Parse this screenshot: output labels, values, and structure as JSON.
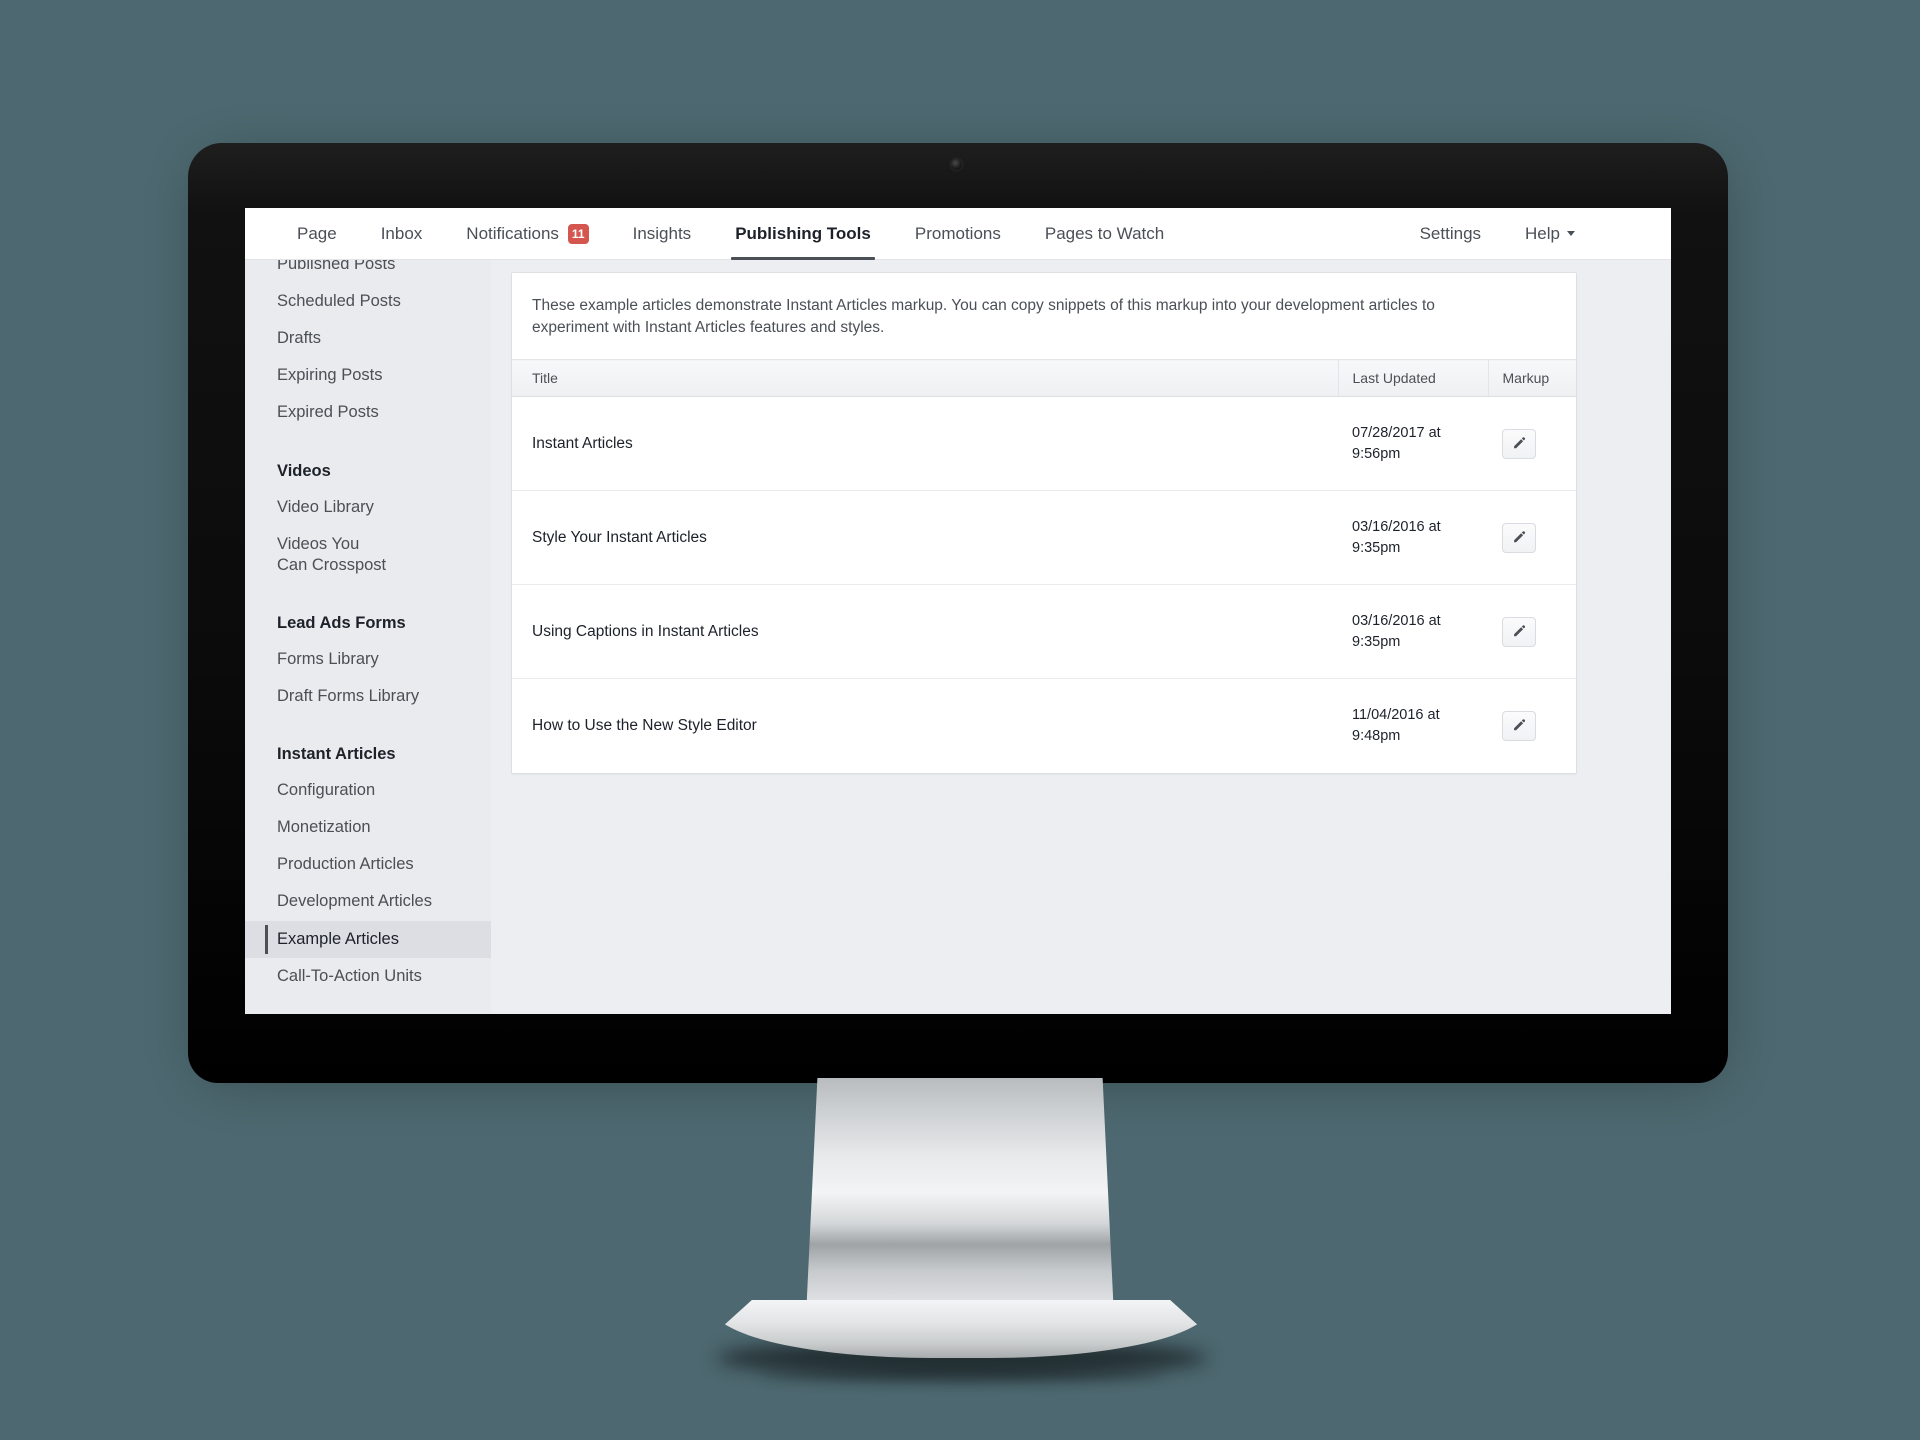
{
  "background_color": "#4d6870",
  "device": {
    "type": "desktop-monitor",
    "camera_label": "webcam"
  },
  "topnav": {
    "left_items": [
      {
        "label": "Page",
        "active": false
      },
      {
        "label": "Inbox",
        "active": false
      },
      {
        "label": "Notifications",
        "active": false,
        "badge": "11"
      },
      {
        "label": "Insights",
        "active": false
      },
      {
        "label": "Publishing Tools",
        "active": true
      },
      {
        "label": "Promotions",
        "active": false
      },
      {
        "label": "Pages to Watch",
        "active": false
      }
    ],
    "right_items": [
      {
        "label": "Settings",
        "caret": false
      },
      {
        "label": "Help",
        "caret": true
      }
    ],
    "badge_color": "#d4564f",
    "active_underline_color": "#4b4f56"
  },
  "sidebar": {
    "groups": [
      {
        "heading": null,
        "items": [
          {
            "label": "Published Posts",
            "selected": false,
            "clipped": true
          },
          {
            "label": "Scheduled Posts",
            "selected": false
          },
          {
            "label": "Drafts",
            "selected": false
          },
          {
            "label": "Expiring Posts",
            "selected": false
          },
          {
            "label": "Expired Posts",
            "selected": false
          }
        ]
      },
      {
        "heading": "Videos",
        "items": [
          {
            "label": "Video Library",
            "selected": false
          },
          {
            "label": "Videos You Can Crosspost",
            "selected": false
          }
        ]
      },
      {
        "heading": "Lead Ads Forms",
        "items": [
          {
            "label": "Forms Library",
            "selected": false
          },
          {
            "label": "Draft Forms Library",
            "selected": false
          }
        ]
      },
      {
        "heading": "Instant Articles",
        "items": [
          {
            "label": "Configuration",
            "selected": false
          },
          {
            "label": "Monetization",
            "selected": false
          },
          {
            "label": "Production Articles",
            "selected": false
          },
          {
            "label": "Development Articles",
            "selected": false
          },
          {
            "label": "Example Articles",
            "selected": true
          },
          {
            "label": "Call-To-Action Units",
            "selected": false
          }
        ]
      }
    ]
  },
  "main": {
    "description": "These example articles demonstrate Instant Articles markup. You can copy snippets of this markup into your development articles to experiment with Instant Articles features and styles.",
    "table": {
      "columns": [
        "Title",
        "Last Updated",
        "Markup"
      ],
      "rows": [
        {
          "title": "Instant Articles",
          "last_updated": "07/28/2017 at 9:56pm",
          "markup_icon": "pencil-icon"
        },
        {
          "title": "Style Your Instant Articles",
          "last_updated": "03/16/2016 at 9:35pm",
          "markup_icon": "pencil-icon"
        },
        {
          "title": "Using Captions in Instant Articles",
          "last_updated": "03/16/2016 at 9:35pm",
          "markup_icon": "pencil-icon"
        },
        {
          "title": "How to Use the New Style Editor",
          "last_updated": "11/04/2016 at 9:48pm",
          "markup_icon": "pencil-icon"
        }
      ]
    }
  }
}
